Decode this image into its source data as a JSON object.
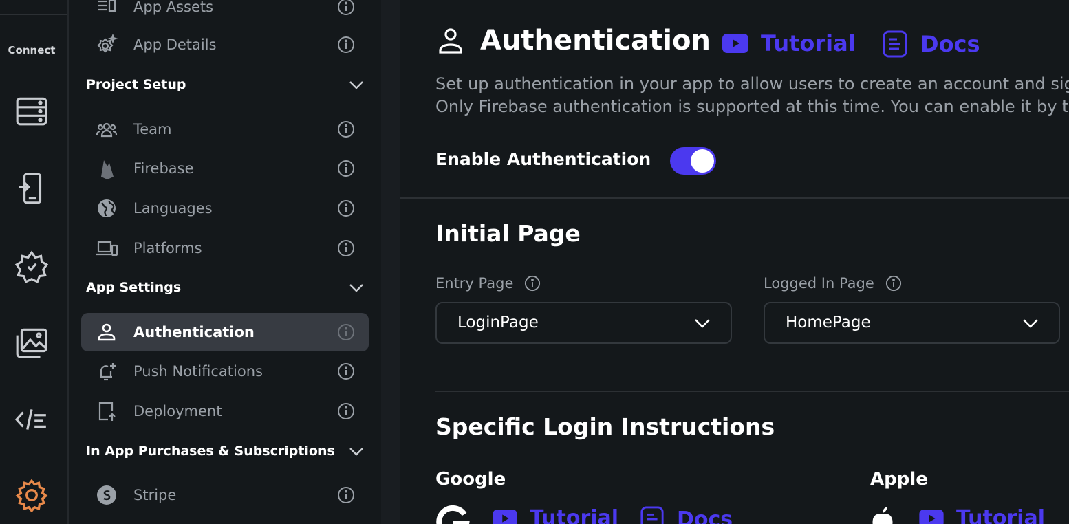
{
  "rail": {
    "connect_label": "Connect"
  },
  "sidebar": {
    "top_items": [
      {
        "label": "App Assets",
        "icon": "assets-icon"
      },
      {
        "label": "App Details",
        "icon": "gear-sparkle-icon"
      }
    ],
    "sections": [
      {
        "label": "Project Setup"
      },
      {
        "label": "App Settings"
      },
      {
        "label": "In App Purchases & Subscriptions"
      }
    ],
    "project_setup_items": [
      {
        "label": "Team",
        "icon": "team-icon"
      },
      {
        "label": "Firebase",
        "icon": "firebase-icon"
      },
      {
        "label": "Languages",
        "icon": "globe-icon"
      },
      {
        "label": "Platforms",
        "icon": "devices-icon"
      }
    ],
    "app_settings_items": [
      {
        "label": "Authentication",
        "icon": "person-icon",
        "active": true
      },
      {
        "label": "Push Notifications",
        "icon": "bell-plus-icon"
      },
      {
        "label": "Deployment",
        "icon": "deploy-icon"
      }
    ],
    "iap_items": [
      {
        "label": "Stripe",
        "icon": "stripe-icon"
      }
    ]
  },
  "main": {
    "title": "Authentication",
    "tutorial_label": "Tutorial",
    "docs_label": "Docs",
    "description_line1": "Set up authentication in your app to allow users to create an account and sign in",
    "description_line2": "Only Firebase authentication is supported at this time. You can enable it by togg",
    "enable_auth_label": "Enable Authentication",
    "enable_auth_on": true,
    "initial_page_heading": "Initial Page",
    "entry_page_label": "Entry Page",
    "entry_page_value": "LoginPage",
    "logged_in_page_label": "Logged In Page",
    "logged_in_page_value": "HomePage",
    "specific_heading": "Specific Login Instructions",
    "google_label": "Google",
    "apple_label": "Apple",
    "google_tutorial_label": "Tutorial",
    "google_docs_label": "Docs",
    "apple_tutorial_label": "Tutorial"
  },
  "colors": {
    "accent": "#4b39ef",
    "settings_active": "#e8894a",
    "text_muted": "#9aa0a7",
    "background": "#14181b"
  }
}
